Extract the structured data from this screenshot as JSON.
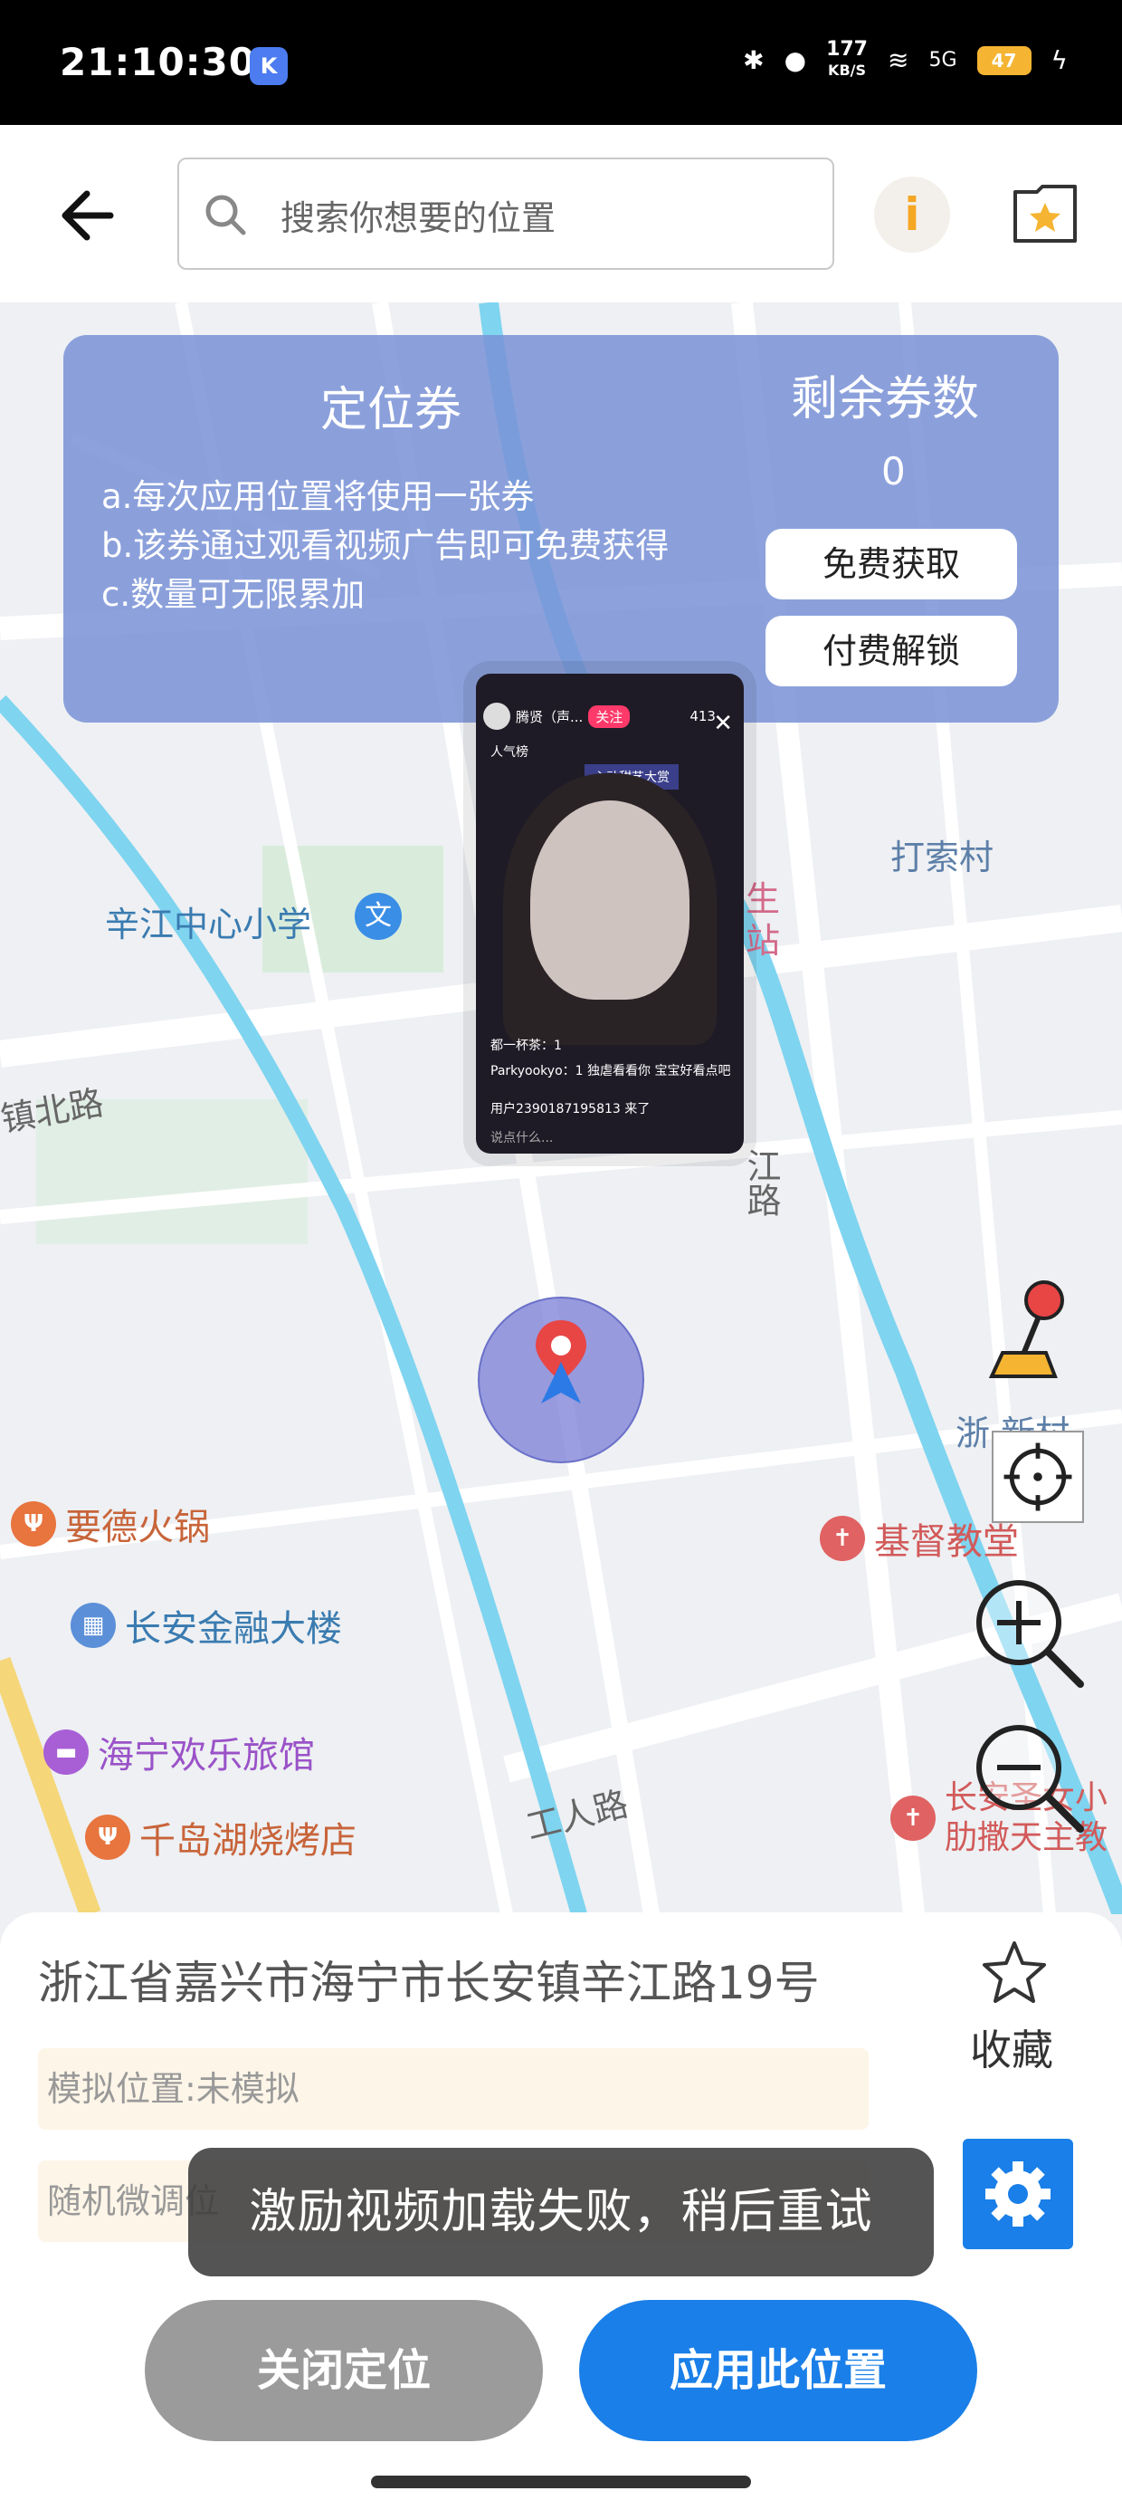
{
  "status_bar": {
    "time": "21:10:30",
    "app_icon": "K",
    "net_speed_value": "177",
    "net_speed_unit": "KB/S",
    "signal_label": "5G",
    "battery": "47"
  },
  "header": {
    "search_placeholder": "搜索你想要的位置",
    "info_icon": "i"
  },
  "coupon": {
    "title": "定位券",
    "rules": [
      "a.每次应用位置将使用一张券",
      "b.该券通过观看视频广告即可免费获得",
      "c.数量可无限累加"
    ],
    "remaining_title": "剩余券数",
    "remaining_count": "0",
    "free_button": "免费获取",
    "paid_button": "付费解锁"
  },
  "ad": {
    "host": "腾贤（声...",
    "follow": "关注",
    "viewers": "413",
    "close": "✕",
    "rank": "人气榜",
    "promo": "心动甜艺大赏",
    "chat": [
      "都一杯茶：1",
      "Parkyookyo：1 独虐看看你 宝宝好看点吧",
      "用户2390187195813 来了",
      "说点什么..."
    ]
  },
  "map": {
    "labels": [
      "辛江中心小学",
      "打索村",
      "镇北路",
      "江路",
      "工人路",
      "卫生区站",
      "浙 新村"
    ],
    "pois": [
      "要德火锅",
      "长安金融大楼",
      "海宁欢乐旅馆",
      "千岛湖烧烤店",
      "基督教堂",
      "长安圣女小 肋撒天主教"
    ],
    "colors": {
      "road_main": "#ffffff",
      "river": "#7fd4f0",
      "highway": "#f5d77a",
      "green": "#d9ecdc"
    }
  },
  "panel": {
    "address": "浙江省嘉兴市海宁市长安镇辛江路19号",
    "favorite_label": "收藏",
    "simulated_location": "模拟位置:未模拟",
    "random_adjust": "随机微调位",
    "toast": "激励视频加载失败，稍后重试",
    "close_button": "关闭定位",
    "apply_button": "应用此位置"
  },
  "colors": {
    "accent": "#1a7fe8",
    "coupon_bg": "#7992d6",
    "toast_bg": "#3c3c3c",
    "close_btn": "#9b9b9b"
  }
}
